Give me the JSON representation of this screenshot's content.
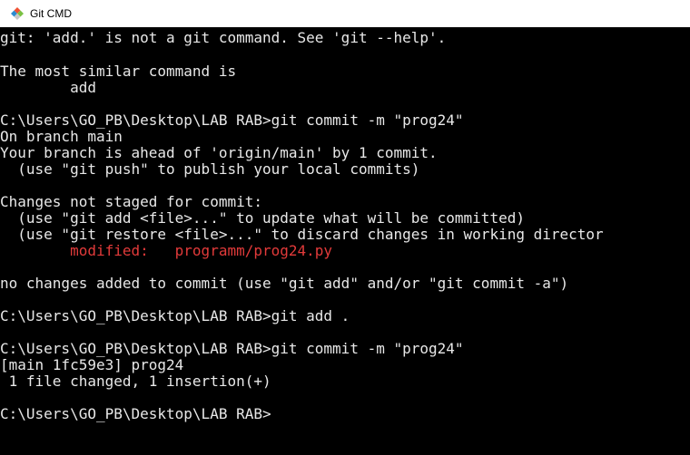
{
  "window": {
    "title": "Git CMD",
    "icon": "git-diamond-icon",
    "colors": {
      "accent_orange": "#f05133",
      "accent_blue": "#2a8bd0",
      "accent_green": "#7ac143"
    }
  },
  "terminal": {
    "colors": {
      "background": "#000000",
      "foreground": "#e8e8e8",
      "modified": "#e23a3a"
    },
    "lines": [
      "git: 'add.' is not a git command. See 'git --help'.",
      "",
      "The most similar command is",
      "        add",
      "",
      "C:\\Users\\GO_PB\\Desktop\\LAB RAB>git commit -m \"prog24\"",
      "On branch main",
      "Your branch is ahead of 'origin/main' by 1 commit.",
      "  (use \"git push\" to publish your local commits)",
      "",
      "Changes not staged for commit:",
      "  (use \"git add <file>...\" to update what will be committed)",
      "  (use \"git restore <file>...\" to discard changes in working director",
      "        modified:   programm/prog24.py",
      "",
      "no changes added to commit (use \"git add\" and/or \"git commit -a\")",
      "",
      "C:\\Users\\GO_PB\\Desktop\\LAB RAB>git add .",
      "",
      "C:\\Users\\GO_PB\\Desktop\\LAB RAB>git commit -m \"prog24\"",
      "[main 1fc59e3] prog24",
      " 1 file changed, 1 insertion(+)",
      "",
      "C:\\Users\\GO_PB\\Desktop\\LAB RAB>"
    ]
  }
}
